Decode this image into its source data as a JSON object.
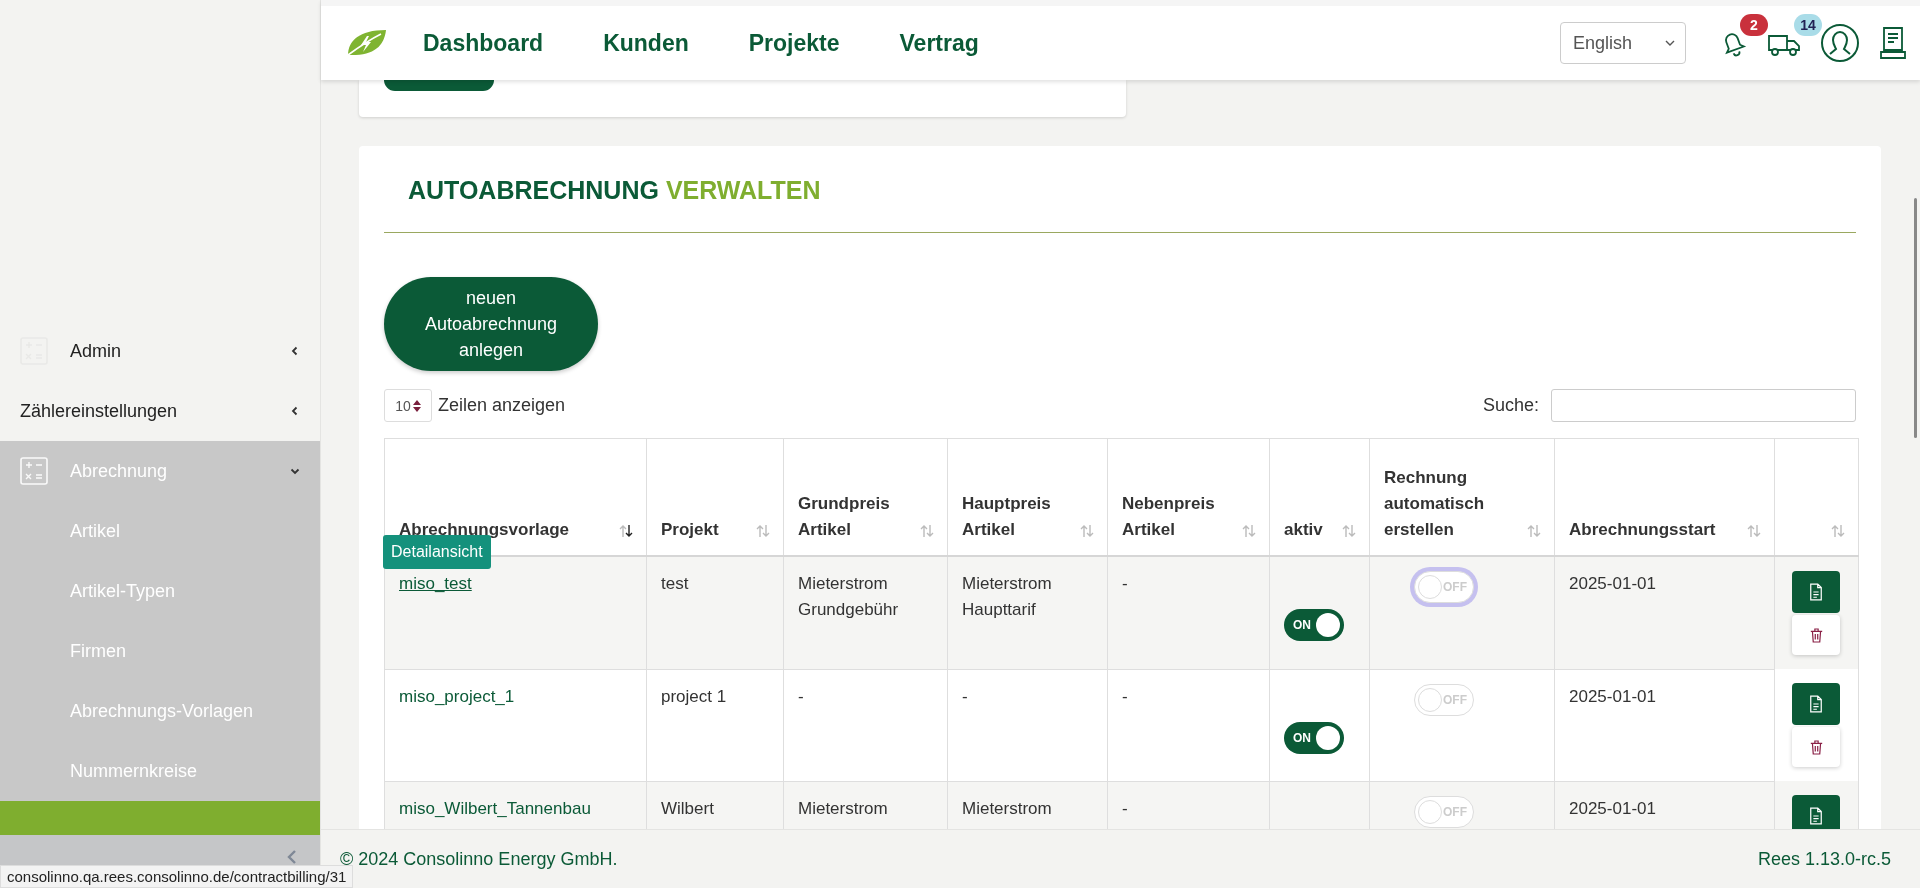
{
  "header": {
    "nav": [
      {
        "label": "Dashboard"
      },
      {
        "label": "Kunden"
      },
      {
        "label": "Projekte"
      },
      {
        "label": "Vertrag"
      }
    ],
    "language": "English",
    "notification_badge": "2",
    "delivery_badge": "14"
  },
  "sidebar": {
    "items": [
      {
        "label": "Admin",
        "kind": "group",
        "icon": true,
        "expanded": false
      },
      {
        "label": "Zählereinstellungen",
        "kind": "group",
        "icon": false,
        "expanded": false
      },
      {
        "label": "Abrechnung",
        "kind": "group",
        "icon": true,
        "expanded": true,
        "children": [
          {
            "label": "Artikel"
          },
          {
            "label": "Artikel-Typen"
          },
          {
            "label": "Firmen"
          },
          {
            "label": "Abrechnungs-Vorlagen"
          },
          {
            "label": "Nummernkreise"
          }
        ]
      }
    ]
  },
  "card": {
    "title_dark": "AUTOABRECHNUNG",
    "title_light": "VERWALTEN",
    "new_button": "neuen Autoabrechnung anlegen",
    "page_size": "10",
    "page_size_label": "Zeilen anzeigen",
    "search_label": "Suche:"
  },
  "table": {
    "columns": [
      {
        "label": "Abrechnungsvorlage",
        "sorted": true
      },
      {
        "label": "Projekt",
        "sorted": false
      },
      {
        "label": "Grundpreis Artikel",
        "sorted": false
      },
      {
        "label": "Hauptpreis Artikel",
        "sorted": false
      },
      {
        "label": "Nebenpreis Artikel",
        "sorted": false
      },
      {
        "label": "aktiv",
        "sorted": false
      },
      {
        "label": "Rechnung automatisch erstellen",
        "sorted": false
      },
      {
        "label": "Abrechnungsstart",
        "sorted": false
      },
      {
        "sorted": false
      }
    ],
    "tooltip": "Detailansicht",
    "rows": [
      {
        "name": "miso_test",
        "hovered": true,
        "project": "test",
        "grundpreis": "Mieterstrom Grundgebühr",
        "hauptpreis": "Mieterstrom Haupttarif",
        "nebenpreis": "-",
        "aktiv": true,
        "aktiv_label": "ON",
        "auto": false,
        "auto_label": "OFF",
        "auto_focused": true,
        "start": "2025-01-01"
      },
      {
        "name": "miso_project_1",
        "hovered": false,
        "project": "project 1",
        "grundpreis": "-",
        "hauptpreis": "-",
        "nebenpreis": "-",
        "aktiv": true,
        "aktiv_label": "ON",
        "auto": false,
        "auto_label": "OFF",
        "auto_focused": false,
        "start": "2025-01-01"
      },
      {
        "name": "miso_Wilbert_Tannenbau",
        "hovered": false,
        "project": "Wilbert",
        "grundpreis": "Mieterstrom",
        "hauptpreis": "Mieterstrom",
        "nebenpreis": "-",
        "auto": false,
        "auto_label": "OFF",
        "auto_focused": false,
        "start": "2025-01-01"
      }
    ]
  },
  "footer": {
    "copyright": "© 2024 Consolinno Energy GmbH.",
    "version": "Rees 1.13.0-rc.5"
  },
  "status_url": "consolinno.qa.rees.consolinno.de/contractbilling/31"
}
